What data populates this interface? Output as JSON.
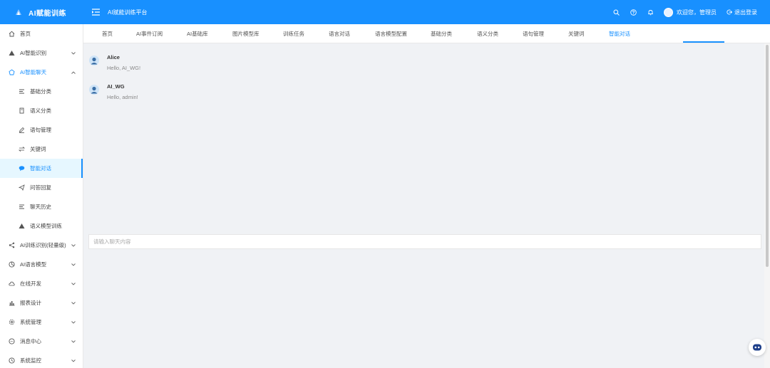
{
  "header": {
    "brand": "AI赋能训练",
    "platform_title": "AI赋能训练平台",
    "user_label": "欢迎您，管理员",
    "logout_label": "退出登录",
    "color": "#1890ff"
  },
  "sidebar": {
    "items": [
      {
        "label": "首页",
        "icon": "home-icon"
      },
      {
        "label": "AI智能识别",
        "icon": "warning-triangle-icon"
      },
      {
        "label": "AI智能聊天",
        "icon": "chat-bot-icon"
      },
      {
        "label": "基础分类",
        "icon": "list-icon"
      },
      {
        "label": "语义分类",
        "icon": "document-icon"
      },
      {
        "label": "语句管理",
        "icon": "edit-icon"
      },
      {
        "label": "关键词",
        "icon": "swap-icon"
      },
      {
        "label": "智能对话",
        "icon": "chat-bubble-icon"
      },
      {
        "label": "问答回复",
        "icon": "send-icon"
      },
      {
        "label": "聊天历史",
        "icon": "list-icon"
      },
      {
        "label": "语义模型训练",
        "icon": "triangle-icon"
      },
      {
        "label": "AI训练识别(轻量级)",
        "icon": "share-icon"
      },
      {
        "label": "AI语言模型",
        "icon": "model-icon"
      },
      {
        "label": "在线开发",
        "icon": "cloud-icon"
      },
      {
        "label": "报表设计",
        "icon": "bar-chart-icon"
      },
      {
        "label": "系统管理",
        "icon": "gear-icon"
      },
      {
        "label": "消息中心",
        "icon": "message-icon"
      },
      {
        "label": "系统监控",
        "icon": "monitor-icon"
      }
    ]
  },
  "tabs": [
    "首页",
    "AI事件订阅",
    "AI基础库",
    "图片模型库",
    "训练任务",
    "语言对话",
    "语言模型配置",
    "基础分类",
    "语义分类",
    "语句管理",
    "关键词",
    "智能对话"
  ],
  "chat": {
    "messages": [
      {
        "name": "Alice",
        "text": "Hello, AI_WG!"
      },
      {
        "name": "AI_WG",
        "text": "Hello, admin!"
      }
    ],
    "input_placeholder": "请输入聊天内容"
  }
}
